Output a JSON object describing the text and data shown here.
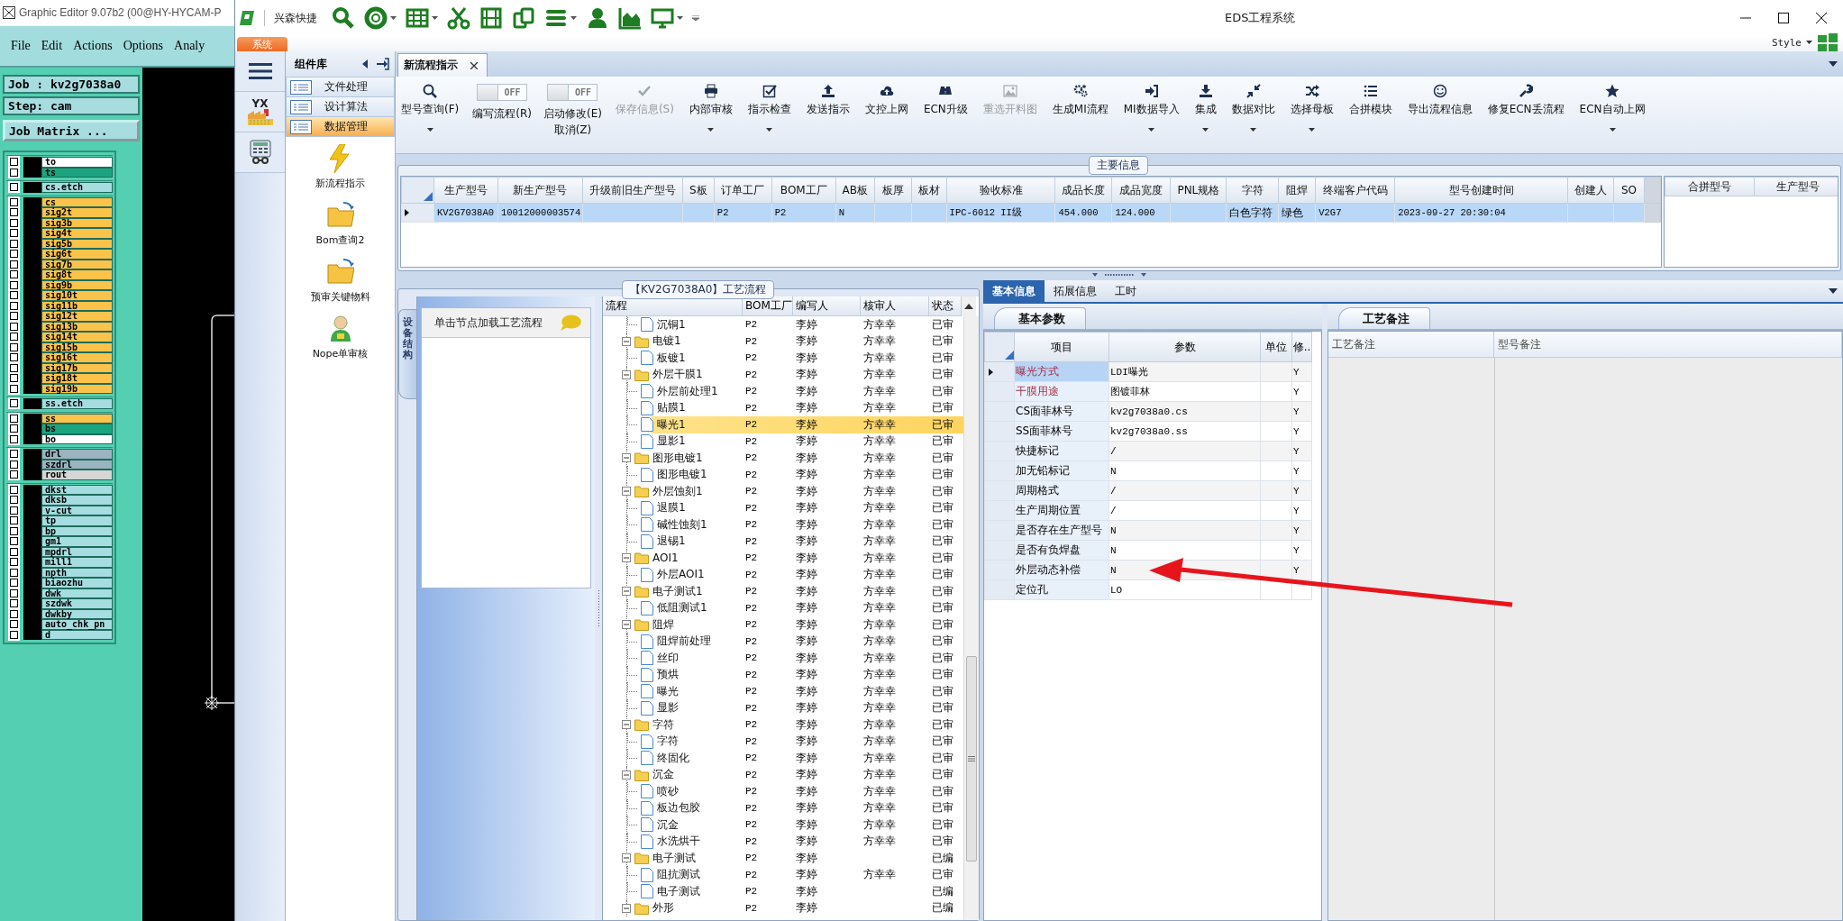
{
  "editor": {
    "title": "Graphic Editor 9.07b2 (00@HY-HYCAM-P",
    "menu": [
      "File",
      "Edit",
      "Actions",
      "Options",
      "Analy"
    ],
    "job": "Job : kv2g7038a0",
    "step": "Step: cam",
    "matrix_button": "Job Matrix ...",
    "layer_groups": [
      [
        {
          "name": "to",
          "color": "#ffffff",
          "checked": false
        },
        {
          "name": "ts",
          "color": "#1aa57e",
          "checked": false
        }
      ],
      [
        {
          "name": "cs.etch",
          "color": "#a6dde0",
          "checked": false
        }
      ],
      [
        {
          "name": "cs",
          "color": "#fcc34a",
          "checked": false
        },
        {
          "name": "sig2t",
          "color": "#fcc34a",
          "checked": false
        },
        {
          "name": "sig3b",
          "color": "#fcc34a",
          "checked": false
        },
        {
          "name": "sig4t",
          "color": "#fcc34a",
          "checked": false
        },
        {
          "name": "sig5b",
          "color": "#fcc34a",
          "checked": false
        },
        {
          "name": "sig6t",
          "color": "#fcc34a",
          "checked": false
        },
        {
          "name": "sig7b",
          "color": "#fcc34a",
          "checked": false
        },
        {
          "name": "sig8t",
          "color": "#fcc34a",
          "checked": false
        },
        {
          "name": "sig9b",
          "color": "#fcc34a",
          "checked": false
        },
        {
          "name": "sig10t",
          "color": "#fcc34a",
          "checked": false
        },
        {
          "name": "sig11b",
          "color": "#fcc34a",
          "checked": false
        },
        {
          "name": "sig12t",
          "color": "#fcc34a",
          "checked": false
        },
        {
          "name": "sig13b",
          "color": "#fcc34a",
          "checked": false
        },
        {
          "name": "sig14t",
          "color": "#fcc34a",
          "checked": false
        },
        {
          "name": "sig15b",
          "color": "#fcc34a",
          "checked": false
        },
        {
          "name": "sig16t",
          "color": "#fcc34a",
          "checked": false
        },
        {
          "name": "sig17b",
          "color": "#fcc34a",
          "checked": false
        },
        {
          "name": "sig18t",
          "color": "#fcc34a",
          "checked": false
        },
        {
          "name": "sig19b",
          "color": "#fcc34a",
          "checked": false
        }
      ],
      [
        {
          "name": "ss.etch",
          "color": "#a6dde0",
          "checked": false
        }
      ],
      [
        {
          "name": "ss",
          "color": "#fcc34a",
          "checked": false
        },
        {
          "name": "bs",
          "color": "#1aa57e",
          "checked": false
        },
        {
          "name": "bo",
          "color": "#ffffff",
          "checked": false
        }
      ],
      [
        {
          "name": "drl",
          "color": "#9cb4bf",
          "checked": false
        },
        {
          "name": "szdrl",
          "color": "#9cb4bf",
          "checked": false
        },
        {
          "name": "rout",
          "color": "#d6d6d6",
          "checked": false
        }
      ],
      [
        {
          "name": "dkst",
          "color": "#a6dde0",
          "checked": false
        },
        {
          "name": "dksb",
          "color": "#a6dde0",
          "checked": false
        },
        {
          "name": "v-cut",
          "color": "#a6dde0",
          "checked": false
        },
        {
          "name": "tp",
          "color": "#a6dde0",
          "checked": false
        },
        {
          "name": "bp",
          "color": "#a6dde0",
          "checked": false
        },
        {
          "name": "gm1",
          "color": "#a6dde0",
          "checked": false
        },
        {
          "name": "mpdrl",
          "color": "#a6dde0",
          "checked": false
        },
        {
          "name": "mill1",
          "color": "#a6dde0",
          "checked": false
        },
        {
          "name": "npth",
          "color": "#a6dde0",
          "checked": false
        },
        {
          "name": "biaozhu",
          "color": "#a6dde0",
          "checked": false
        },
        {
          "name": "dwk",
          "color": "#a6dde0",
          "checked": false
        },
        {
          "name": "szdwk",
          "color": "#a6dde0",
          "checked": false
        },
        {
          "name": "dwkby",
          "color": "#a6dde0",
          "checked": false
        },
        {
          "name": "auto_chk_pn",
          "color": "#a6dde0",
          "checked": false
        },
        {
          "name": "d",
          "color": "#a6dde0",
          "checked": false
        }
      ]
    ]
  },
  "app": {
    "quick_label": "兴森快捷",
    "title": "EDS工程系统",
    "system_tab": "系统",
    "style_menu": "Style",
    "rail_logo": "YX"
  },
  "components": {
    "title": "组件库",
    "categories": [
      {
        "label": "文件处理",
        "selected": false
      },
      {
        "label": "设计算法",
        "selected": false
      },
      {
        "label": "数据管理",
        "selected": true
      }
    ],
    "items": [
      "新流程指示",
      "Bom查询2",
      "预审关键物料",
      "Nope单审核"
    ]
  },
  "document_tab": "新流程指示",
  "ribbon": [
    {
      "kind": "button",
      "label": "型号查询(F)",
      "disabled": false,
      "dropdown": true
    },
    {
      "kind": "toggle",
      "label": "编写流程(R)",
      "switch_text": "OFF",
      "on": false
    },
    {
      "kind": "toggle",
      "label": "启动修改(E)",
      "sublabel": "取消(Z)",
      "switch_text": "OFF",
      "on": false
    },
    {
      "kind": "button",
      "label": "保存信息(S)",
      "disabled": true,
      "dropdown": false
    },
    {
      "kind": "button",
      "label": "内部审核",
      "disabled": false,
      "dropdown": true
    },
    {
      "kind": "button",
      "label": "指示检查",
      "disabled": false,
      "dropdown": true
    },
    {
      "kind": "button",
      "label": "发送指示",
      "disabled": false,
      "dropdown": false
    },
    {
      "kind": "button",
      "label": "文控上网",
      "disabled": false,
      "dropdown": false
    },
    {
      "kind": "button",
      "label": "ECN升级",
      "disabled": false,
      "dropdown": false
    },
    {
      "kind": "button",
      "label": "重选开料图",
      "disabled": true,
      "dropdown": false
    },
    {
      "kind": "button",
      "label": "生成MI流程",
      "disabled": false,
      "dropdown": false
    },
    {
      "kind": "button",
      "label": "MI数据导入",
      "disabled": false,
      "dropdown": true
    },
    {
      "kind": "button",
      "label": "集成",
      "disabled": false,
      "dropdown": true
    },
    {
      "kind": "button",
      "label": "数据对比",
      "disabled": false,
      "dropdown": true
    },
    {
      "kind": "button",
      "label": "选择母板",
      "disabled": false,
      "dropdown": true
    },
    {
      "kind": "button",
      "label": "合拼模块",
      "disabled": false,
      "dropdown": false
    },
    {
      "kind": "button",
      "label": "导出流程信息",
      "disabled": false,
      "dropdown": false
    },
    {
      "kind": "button",
      "label": "修复ECN丢流程",
      "disabled": false,
      "dropdown": false
    },
    {
      "kind": "button",
      "label": "ECN自动上网",
      "disabled": false,
      "dropdown": true
    }
  ],
  "main_info": {
    "title": "主要信息",
    "columns": [
      "生产型号",
      "新生产型号",
      "升级前旧生产型号",
      "S板",
      "订单工厂",
      "BOM工厂",
      "AB板",
      "板厚",
      "板材",
      "验收标准",
      "成品长度",
      "成品宽度",
      "PNL规格",
      "字符",
      "阻焊",
      "终端客户代码",
      "型号创建时间",
      "创建人",
      "SO"
    ],
    "rows": [
      {
        "selected": true,
        "cells": [
          "KV2G7038A0",
          "10012000003574",
          null,
          null,
          "P2",
          "P2",
          "N",
          null,
          null,
          "IPC-6012 II级",
          "454.000",
          "124.000",
          null,
          "白色字符",
          "绿色",
          "V2G7",
          "2023-09-27 20:30:04",
          null,
          null
        ]
      }
    ],
    "merge_columns": [
      "合拼型号",
      "生产型号"
    ]
  },
  "flow": {
    "title": "【KV2G7038A0】工艺流程",
    "side_tab": "设备结构",
    "hint": "单击节点加载工艺流程",
    "columns": [
      "流程",
      "BOM工厂",
      "编写人",
      "核审人",
      "状态"
    ],
    "rows": [
      {
        "name": "沉铜1",
        "bom": "P2",
        "writer": "李婷",
        "reviewer": "方幸幸",
        "status": "已审",
        "selected": false
      },
      {
        "name": "电镀1",
        "bom": "P2",
        "writer": "李婷",
        "reviewer": "方幸幸",
        "status": "已审",
        "selected": false,
        "expanded": true,
        "children": [
          {
            "name": "板镀1",
            "bom": "P2",
            "writer": "李婷",
            "reviewer": "方幸幸",
            "status": "已审",
            "selected": false
          }
        ]
      },
      {
        "name": "外层干膜1",
        "bom": "P2",
        "writer": "李婷",
        "reviewer": "方幸幸",
        "status": "已审",
        "selected": false,
        "expanded": true,
        "children": [
          {
            "name": "外层前处理1",
            "bom": "P2",
            "writer": "李婷",
            "reviewer": "方幸幸",
            "status": "已审",
            "selected": false
          },
          {
            "name": "贴膜1",
            "bom": "P2",
            "writer": "李婷",
            "reviewer": "方幸幸",
            "status": "已审",
            "selected": false
          },
          {
            "name": "曝光1",
            "bom": "P2",
            "writer": "李婷",
            "reviewer": "方幸幸",
            "status": "已审",
            "selected": true
          },
          {
            "name": "显影1",
            "bom": "P2",
            "writer": "李婷",
            "reviewer": "方幸幸",
            "status": "已审",
            "selected": false
          }
        ]
      },
      {
        "name": "图形电镀1",
        "bom": "P2",
        "writer": "李婷",
        "reviewer": "方幸幸",
        "status": "已审",
        "selected": false,
        "expanded": true,
        "children": [
          {
            "name": "图形电镀1",
            "bom": "P2",
            "writer": "李婷",
            "reviewer": "方幸幸",
            "status": "已审",
            "selected": false
          }
        ]
      },
      {
        "name": "外层蚀刻1",
        "bom": "P2",
        "writer": "李婷",
        "reviewer": "方幸幸",
        "status": "已审",
        "selected": false,
        "expanded": true,
        "children": [
          {
            "name": "退膜1",
            "bom": "P2",
            "writer": "李婷",
            "reviewer": "方幸幸",
            "status": "已审",
            "selected": false
          },
          {
            "name": "碱性蚀刻1",
            "bom": "P2",
            "writer": "李婷",
            "reviewer": "方幸幸",
            "status": "已审",
            "selected": false
          },
          {
            "name": "退锡1",
            "bom": "P2",
            "writer": "李婷",
            "reviewer": "方幸幸",
            "status": "已审",
            "selected": false
          }
        ]
      },
      {
        "name": "AOI1",
        "bom": "P2",
        "writer": "李婷",
        "reviewer": "方幸幸",
        "status": "已审",
        "selected": false,
        "expanded": true,
        "children": [
          {
            "name": "外层AOI1",
            "bom": "P2",
            "writer": "李婷",
            "reviewer": "方幸幸",
            "status": "已审",
            "selected": false
          }
        ]
      },
      {
        "name": "电子测试1",
        "bom": "P2",
        "writer": "李婷",
        "reviewer": "方幸幸",
        "status": "已审",
        "selected": false,
        "expanded": true,
        "children": [
          {
            "name": "低阻测试1",
            "bom": "P2",
            "writer": "李婷",
            "reviewer": "方幸幸",
            "status": "已审",
            "selected": false
          }
        ]
      },
      {
        "name": "阻焊",
        "bom": "P2",
        "writer": "李婷",
        "reviewer": "方幸幸",
        "status": "已审",
        "selected": false,
        "expanded": true,
        "children": [
          {
            "name": "阻焊前处理",
            "bom": "P2",
            "writer": "李婷",
            "reviewer": "方幸幸",
            "status": "已审",
            "selected": false
          },
          {
            "name": "丝印",
            "bom": "P2",
            "writer": "李婷",
            "reviewer": "方幸幸",
            "status": "已审",
            "selected": false
          },
          {
            "name": "预烘",
            "bom": "P2",
            "writer": "李婷",
            "reviewer": "方幸幸",
            "status": "已审",
            "selected": false
          },
          {
            "name": "曝光",
            "bom": "P2",
            "writer": "李婷",
            "reviewer": "方幸幸",
            "status": "已审",
            "selected": false
          },
          {
            "name": "显影",
            "bom": "P2",
            "writer": "李婷",
            "reviewer": "方幸幸",
            "status": "已审",
            "selected": false
          }
        ]
      },
      {
        "name": "字符",
        "bom": "P2",
        "writer": "李婷",
        "reviewer": "方幸幸",
        "status": "已审",
        "selected": false,
        "expanded": true,
        "children": [
          {
            "name": "字符",
            "bom": "P2",
            "writer": "李婷",
            "reviewer": "方幸幸",
            "status": "已审",
            "selected": false
          },
          {
            "name": "终固化",
            "bom": "P2",
            "writer": "李婷",
            "reviewer": "方幸幸",
            "status": "已审",
            "selected": false
          }
        ]
      },
      {
        "name": "沉金",
        "bom": "P2",
        "writer": "李婷",
        "reviewer": "方幸幸",
        "status": "已审",
        "selected": false,
        "expanded": true,
        "children": [
          {
            "name": "喷砂",
            "bom": "P2",
            "writer": "李婷",
            "reviewer": "方幸幸",
            "status": "已审",
            "selected": false
          },
          {
            "name": "板边包胶",
            "bom": "P2",
            "writer": "李婷",
            "reviewer": "方幸幸",
            "status": "已审",
            "selected": false
          },
          {
            "name": "沉金",
            "bom": "P2",
            "writer": "李婷",
            "reviewer": "方幸幸",
            "status": "已审",
            "selected": false
          },
          {
            "name": "水洗烘干",
            "bom": "P2",
            "writer": "李婷",
            "reviewer": "方幸幸",
            "status": "已审",
            "selected": false
          }
        ]
      },
      {
        "name": "电子测试",
        "bom": "P2",
        "writer": "李婷",
        "status": "已编",
        "selected": false,
        "expanded": true,
        "children": [
          {
            "name": "阻抗测试",
            "bom": "P2",
            "writer": "李婷",
            "reviewer": "方幸幸",
            "status": "已审",
            "selected": false
          },
          {
            "name": "电子测试",
            "bom": "P2",
            "writer": "李婷",
            "status": "已编",
            "selected": false
          }
        ]
      },
      {
        "name": "外形",
        "bom": "P2",
        "writer": "李婷",
        "status": "已编",
        "selected": false,
        "expanded": true
      }
    ]
  },
  "details": {
    "tabs": [
      {
        "label": "基本信息",
        "selected": true
      },
      {
        "label": "拓展信息",
        "selected": false
      },
      {
        "label": "工时",
        "selected": false
      }
    ],
    "params": {
      "tab": "基本参数",
      "columns": [
        "项目",
        "参数",
        "单位",
        "修.."
      ],
      "rows": [
        {
          "item": "曝光方式",
          "value": "LDI曝光",
          "flag": "Y",
          "required": true,
          "selected": true
        },
        {
          "item": "干膜用途",
          "value": "图镀菲林",
          "flag": "Y",
          "required": true,
          "selected": false
        },
        {
          "item": "CS面菲林号",
          "value": "kv2g7038a0.cs",
          "flag": "Y",
          "required": false,
          "selected": false
        },
        {
          "item": "SS面菲林号",
          "value": "kv2g7038a0.ss",
          "flag": "Y",
          "required": false,
          "selected": false
        },
        {
          "item": "快捷标记",
          "value": "/",
          "flag": "Y",
          "required": false,
          "selected": false
        },
        {
          "item": "加无铅标记",
          "value": "N",
          "flag": "Y",
          "required": false,
          "selected": false
        },
        {
          "item": "周期格式",
          "value": "/",
          "flag": "Y",
          "required": false,
          "selected": false
        },
        {
          "item": "生产周期位置",
          "value": "/",
          "flag": "Y",
          "required": false,
          "selected": false
        },
        {
          "item": "是否存在生产型号",
          "value": "N",
          "flag": "Y",
          "required": false,
          "selected": false
        },
        {
          "item": "是否有负焊盘",
          "value": "N",
          "flag": "Y",
          "required": false,
          "selected": false
        },
        {
          "item": "外层动态补偿",
          "value": "N",
          "flag": "Y",
          "required": false,
          "selected": false
        },
        {
          "item": "定位孔",
          "value": "LO",
          "required": false,
          "selected": false
        }
      ]
    },
    "notes": {
      "tab": "工艺备注",
      "columns": [
        "工艺备注",
        "型号备注"
      ]
    }
  }
}
